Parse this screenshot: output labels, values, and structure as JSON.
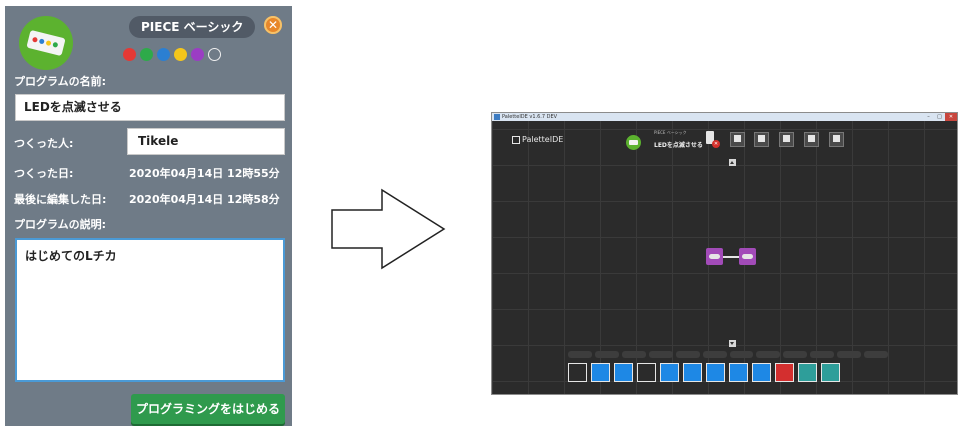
{
  "dialog": {
    "kind_badge": "PIECE ベーシック",
    "close_glyph": "✕",
    "colors": [
      "#e53935",
      "#2eaa4a",
      "#2b7fd2",
      "#f5c61b",
      "#9b3dc4",
      "ring"
    ],
    "name_label": "プログラムの名前:",
    "name_value": "LEDを点滅させる",
    "author_label": "つくった人:",
    "author_value": "Tikele",
    "created_label": "つくった日:",
    "created_value": "2020年04月14日 12時55分",
    "edited_label": "最後に編集した日:",
    "edited_value": "2020年04月14日 12時58分",
    "desc_label": "プログラムの説明:",
    "desc_value": "はじめてのLチカ",
    "start_button": "プログラミングをはじめる"
  },
  "ide": {
    "window_title": "PaletteIDE v1.6.7 DEV",
    "logo": "PaletteIDE",
    "program_kind": "PIECE ベーシック",
    "program_name": "LEDを点滅させる",
    "tools": [
      {
        "icon": "gear-icon"
      },
      {
        "icon": "undo-icon"
      },
      {
        "icon": "save-icon"
      },
      {
        "icon": "camera-icon"
      },
      {
        "icon": "close-icon"
      }
    ],
    "palette_colors": [
      "#1e88e5",
      "#1e88e5",
      "#1e88e5",
      "#1e88e5",
      "#1e88e5",
      "#1e88e5",
      "#1e88e5",
      "#1e88e5",
      "#1e88e5",
      "#d32f2f",
      "#2e9e9a",
      "#2e9e9a"
    ]
  }
}
